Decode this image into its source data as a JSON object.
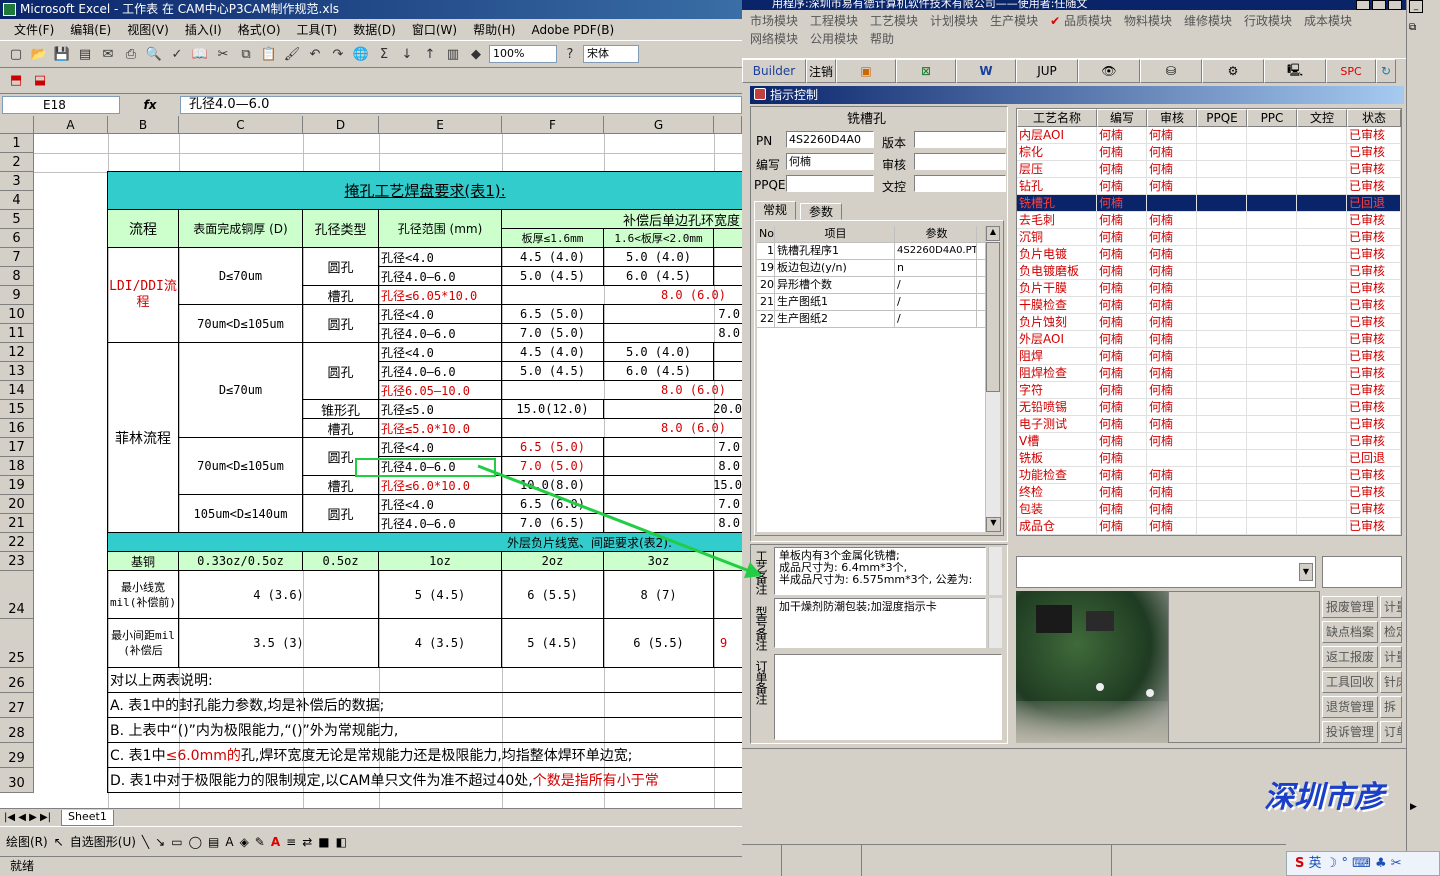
{
  "excel": {
    "title": "Microsoft Excel - 工作表 在 CAM中心P3CAM制作规范.xls",
    "menu": [
      "文件(F)",
      "编辑(E)",
      "视图(V)",
      "插入(I)",
      "格式(O)",
      "工具(T)",
      "数据(D)",
      "窗口(W)",
      "帮助(H)",
      "Adobe PDF(B)"
    ],
    "zoom": "100%",
    "font": "宋体",
    "namebox": "E18",
    "fx": "fx",
    "formula": "孔径4.0—6.0",
    "columns": [
      "A",
      "B",
      "C",
      "D",
      "E",
      "F",
      "G"
    ],
    "rows": [
      "1",
      "2",
      "3",
      "4",
      "5",
      "6",
      "7",
      "8",
      "9",
      "10",
      "11",
      "12",
      "13",
      "14",
      "15",
      "16",
      "17",
      "18",
      "19",
      "20",
      "21",
      "22",
      "23",
      "24",
      "25",
      "26",
      "27",
      "28",
      "29",
      "30"
    ],
    "table1_title": "掩孔工艺焊盘要求(表1):",
    "header": {
      "flow": "流程",
      "copper": "表面完成铜厚 (D)",
      "holetype": "孔径类型",
      "holerange": "孔径范围 (mm)",
      "comp": "补偿后单边孔环宽度",
      "f6": "板厚≤1.6mm",
      "g6": "1.6<板厚<2.0mm"
    },
    "flow_ldi": "LDI/DDI流程",
    "flow_fl": "菲林流程",
    "d70": "D≤70um",
    "d70_105": "70um<D≤105um",
    "d105_140": "105um<D≤140um",
    "round": "圆孔",
    "slot": "槽孔",
    "taper": "锥形孔",
    "r7": [
      "孔径<4.0",
      "4.5 (4.0)",
      "5.0 (4.0)"
    ],
    "r8": [
      "孔径4.0—6.0",
      "5.0 (4.5)",
      "6.0 (4.5)"
    ],
    "r9": [
      "孔径≤6.05*10.0",
      "8.0 (6.0)"
    ],
    "r10": [
      "孔径<4.0",
      "6.5 (5.0)",
      "7.0"
    ],
    "r11": [
      "孔径4.0—6.0",
      "7.0 (5.0)",
      "8.0"
    ],
    "r12": [
      "孔径<4.0",
      "4.5 (4.0)",
      "5.0 (4.0)"
    ],
    "r13": [
      "孔径4.0—6.0",
      "5.0 (4.5)",
      "6.0 (4.5)"
    ],
    "r14": [
      "孔径6.05—10.0",
      "8.0 (6.0)"
    ],
    "r15": [
      "孔径≤5.0",
      "15.0(12.0)",
      "20.0"
    ],
    "r16": [
      "孔径≤5.0*10.0",
      "8.0 (6.0)"
    ],
    "r17": [
      "孔径<4.0",
      "6.5 (5.0)",
      "7.0"
    ],
    "r18": [
      "孔径4.0—6.0",
      "7.0 (5.0)",
      "8.0"
    ],
    "r19": [
      "孔径≤6.0*10.0",
      "10.0(8.0)",
      "15.0"
    ],
    "r20": [
      "孔径<4.0",
      "6.5 (6.0)",
      "7.0"
    ],
    "r21": [
      "孔径4.0—6.0",
      "7.0 (6.5)",
      "8.0"
    ],
    "table2_title": "外层负片线宽、间距要求(表2):",
    "r23": [
      "基铜",
      "0.33oz/0.5oz",
      "0.5oz",
      "1oz",
      "2oz",
      "3oz"
    ],
    "r24": [
      "最小线宽mil(补偿前)",
      "4 (3.6)",
      "5 (4.5)",
      "6 (5.5)",
      "8 (7)"
    ],
    "r25": [
      "最小间距mil (补偿后",
      "3.5 (3)",
      "4 (3.5)",
      "5 (4.5)",
      "6 (5.5)",
      "9"
    ],
    "notes": [
      "对以上两表说明:",
      "A. 表1中的封孔能力参数,均是补偿后的数据;",
      "B. 上表中“()”内为极限能力,“()”外为常规能力,",
      "C. 表1中",
      "≤6.0mm的",
      "孔,焊环宽度无论是常规能力还是极限能力,均指整体焊环单边宽;",
      "D. 表1中对于极限能力的限制规定,以CAM单只文件为准不超过40处,",
      "个数是指所有小于常"
    ],
    "sheet_tab": "Sheet1",
    "draw": "绘图(R)",
    "autoshape": "自选图形(U)",
    "status": "就绪"
  },
  "app": {
    "title": "用程序:深圳市易有德计算机软件技术有限公司——使用者:任随文",
    "menu1": [
      "市场模块",
      "工程模块",
      "工艺模块",
      "计划模块",
      "生产模块",
      "品质模块",
      "物料模块",
      "维修模块",
      "行政模块",
      "成本模块"
    ],
    "menu2": [
      "网络模块",
      "公用模块",
      "帮助"
    ],
    "buttons": [
      "Builder",
      "注销",
      "JUP",
      "SPC"
    ],
    "panel_title": "指示控制",
    "process_name": "铣槽孔",
    "pn_label": "PN",
    "pn": "4S2260D4A0",
    "version_label": "版本",
    "author_label": "编写",
    "author": "何楠",
    "review_label": "审核",
    "ppqe_label": "PPQE",
    "doc_label": "文控",
    "tabs": [
      "常规",
      "参数"
    ],
    "param_headers": [
      "No",
      "项目",
      "参数"
    ],
    "params": [
      [
        "1",
        "铣槽孔程序1",
        "4S2260D4A0.PT"
      ],
      [
        "19",
        "板边包边(y/n)",
        "n"
      ],
      [
        "20",
        "异形槽个数",
        "/"
      ],
      [
        "21",
        "生产图纸1",
        "/"
      ],
      [
        "22",
        "生产图纸2",
        "/"
      ]
    ],
    "proc_headers": [
      "工艺名称",
      "编写",
      "审核",
      "PPQE",
      "PPC",
      "文控",
      "状态"
    ],
    "processes": [
      [
        "内层AOI",
        "何楠",
        "何楠",
        "已审核"
      ],
      [
        "棕化",
        "何楠",
        "何楠",
        "已审核"
      ],
      [
        "层压",
        "何楠",
        "何楠",
        "已审核"
      ],
      [
        "钻孔",
        "何楠",
        "何楠",
        "已审核"
      ],
      [
        "铣槽孔",
        "何楠",
        "",
        "已回退"
      ],
      [
        "去毛刺",
        "何楠",
        "何楠",
        "已审核"
      ],
      [
        "沉铜",
        "何楠",
        "何楠",
        "已审核"
      ],
      [
        "负片电镀",
        "何楠",
        "何楠",
        "已审核"
      ],
      [
        "负电镀磨板",
        "何楠",
        "何楠",
        "已审核"
      ],
      [
        "负片干膜",
        "何楠",
        "何楠",
        "已审核"
      ],
      [
        "干膜检查",
        "何楠",
        "何楠",
        "已审核"
      ],
      [
        "负片蚀刻",
        "何楠",
        "何楠",
        "已审核"
      ],
      [
        "外层AOI",
        "何楠",
        "何楠",
        "已审核"
      ],
      [
        "阻焊",
        "何楠",
        "何楠",
        "已审核"
      ],
      [
        "阻焊检查",
        "何楠",
        "何楠",
        "已审核"
      ],
      [
        "字符",
        "何楠",
        "何楠",
        "已审核"
      ],
      [
        "无铅喷锡",
        "何楠",
        "何楠",
        "已审核"
      ],
      [
        "电子测试",
        "何楠",
        "何楠",
        "已审核"
      ],
      [
        "V槽",
        "何楠",
        "何楠",
        "已审核"
      ],
      [
        "铣板",
        "何楠",
        "",
        "已回退"
      ],
      [
        "功能检查",
        "何楠",
        "何楠",
        "已审核"
      ],
      [
        "终检",
        "何楠",
        "何楠",
        "已审核"
      ],
      [
        "包装",
        "何楠",
        "何楠",
        "已审核"
      ],
      [
        "成品仓",
        "何楠",
        "何楠",
        "已审核"
      ]
    ],
    "note_labels": [
      "工艺备注",
      "型号备注",
      "订单备注"
    ],
    "process_note": "单板内有3个金属化铣槽;\n成品尺寸为: 6.4mm*3个,\n半成品尺寸为: 6.575mm*3个, 公差为:",
    "model_note": "加干燥剂防潮包装;加湿度指示卡",
    "side_buttons": [
      [
        "报废管理",
        "计量"
      ],
      [
        "缺点档案",
        "检定"
      ],
      [
        "返工报废",
        "计量"
      ],
      [
        "工具回收",
        "针床"
      ],
      [
        "退货管理",
        "拆"
      ],
      [
        "投诉管理",
        "订单"
      ]
    ],
    "logo": "深圳市彦",
    "taskbar": "英"
  },
  "colors": {
    "teal": "#33cccc",
    "mint": "#ccffcc",
    "red": "#d00000",
    "navy": "#0a246a",
    "green_arrow": "#22cc44"
  }
}
